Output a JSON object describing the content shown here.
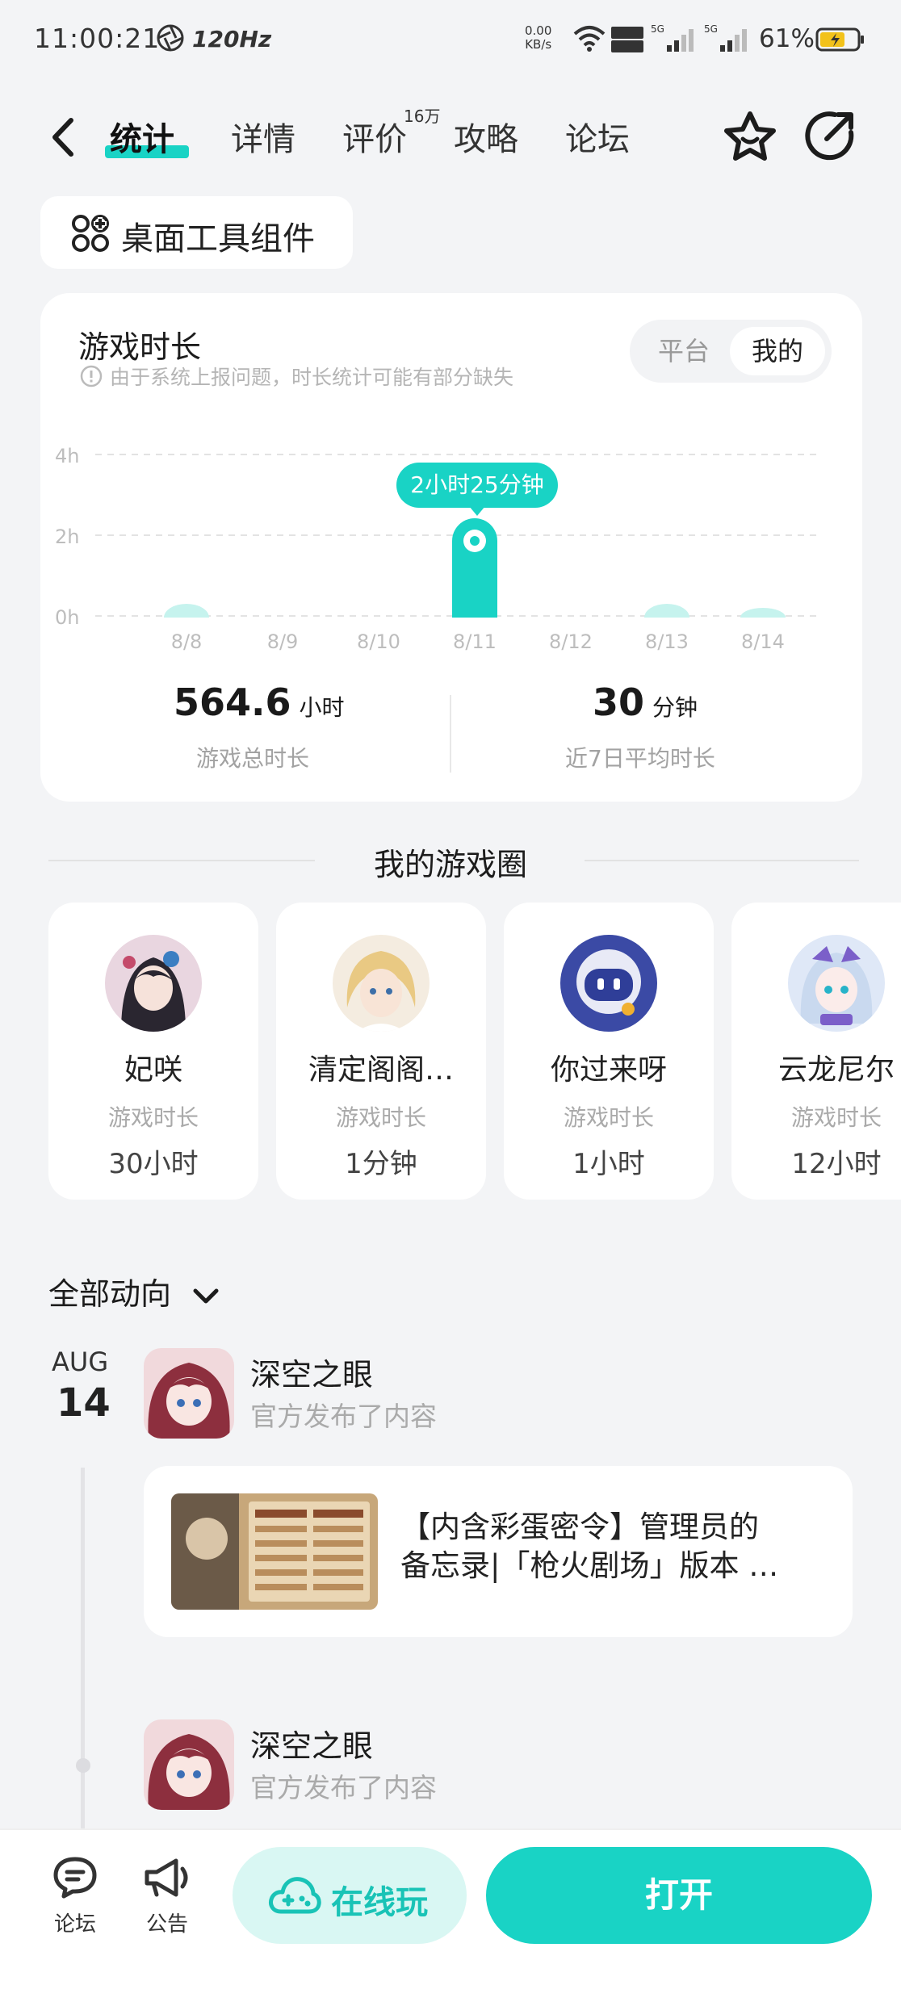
{
  "status_bar": {
    "time": "11:00:21",
    "refresh": "120Hz",
    "net_speed_value": "0.00",
    "net_speed_unit": "KB/s",
    "battery": "61%"
  },
  "nav": {
    "tabs": [
      {
        "label": "统计"
      },
      {
        "label": "详情"
      },
      {
        "label": "评价"
      },
      {
        "label": "攻略"
      },
      {
        "label": "论坛"
      }
    ],
    "review_badge": "16万"
  },
  "widget_button": {
    "label": "桌面工具组件"
  },
  "playtime": {
    "title": "游戏时长",
    "note": "由于系统上报问题，时长统计可能有部分缺失",
    "toggle": [
      "平台",
      "我的"
    ],
    "tooltip": "2小时25分钟",
    "total_value": "564.6",
    "total_unit": "小时",
    "total_label": "游戏总时长",
    "avg_value": "30",
    "avg_unit": "分钟",
    "avg_label": "近7日平均时长"
  },
  "chart_data": {
    "type": "bar",
    "categories": [
      "8/8",
      "8/9",
      "8/10",
      "8/11",
      "8/12",
      "8/13",
      "8/14"
    ],
    "values": [
      0.3,
      0,
      0,
      2.42,
      0,
      0.3,
      0.2
    ],
    "ylabel": "",
    "yticks": [
      "4h",
      "2h",
      "0h"
    ],
    "ylim": [
      0,
      4
    ],
    "grid": true,
    "highlight_index": 3,
    "color": "#19d3c5"
  },
  "circle": {
    "title": "我的游戏圈",
    "items": [
      {
        "name": "妃咲",
        "sub": "游戏时长",
        "value": "30小时"
      },
      {
        "name": "清定阁阁…",
        "sub": "游戏时长",
        "value": "1分钟"
      },
      {
        "name": "你过来呀",
        "sub": "游戏时长",
        "value": "1小时"
      },
      {
        "name": "云龙尼尔",
        "sub": "游戏时长",
        "value": "12小时"
      }
    ]
  },
  "feed": {
    "filter": "全部动向",
    "month": "AUG",
    "day": "14",
    "entries": [
      {
        "name": "深空之眼",
        "sub": "官方发布了内容"
      },
      {
        "name": "深空之眼",
        "sub": "官方发布了内容"
      }
    ],
    "post": {
      "line1": "【内含彩蛋密令】管理员的",
      "line2": "备忘录|「枪火剧场」版本 …"
    }
  },
  "bottom_bar": {
    "forum": "论坛",
    "notice": "公告",
    "play_online": "在线玩",
    "open": "打开"
  }
}
